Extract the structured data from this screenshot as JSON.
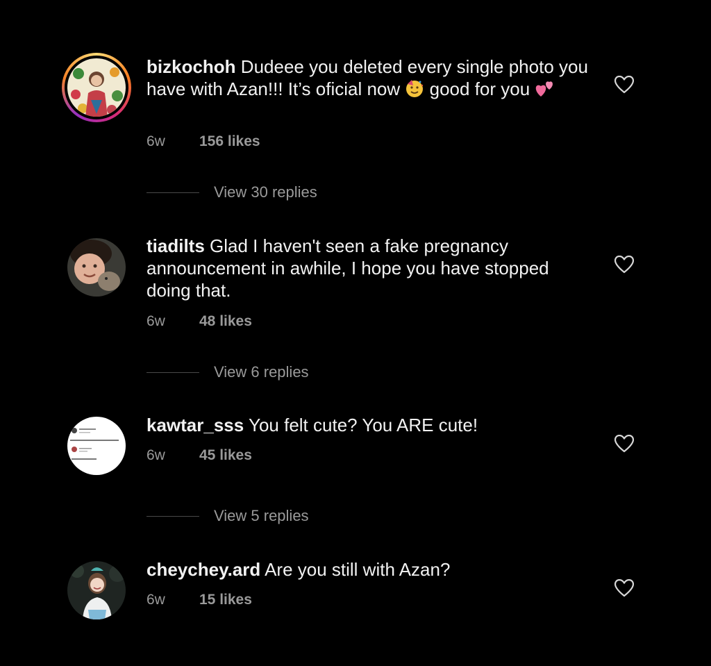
{
  "comments": [
    {
      "username": "bizkochoh",
      "text_part1": "Dudeee you deleted every single photo you have with Azan!!! It’s oficial now",
      "text_part2": "good for you",
      "emoji1": "partying-face-emoji",
      "emoji2": "two-hearts-emoji",
      "age": "6w",
      "likes": "156 likes",
      "replies": "View 30 replies",
      "has_story_ring": true
    },
    {
      "username": "tiadilts",
      "text": "Glad I haven't seen a fake pregnancy announcement in awhile, I hope you have stopped doing that.",
      "age": "6w",
      "likes": "48 likes",
      "replies": "View 6 replies"
    },
    {
      "username": "kawtar_sss",
      "text": "You felt cute? You ARE cute!",
      "age": "6w",
      "likes": "45 likes",
      "replies": "View 5 replies"
    },
    {
      "username": "cheychey.ard",
      "text": "Are you still with Azan?",
      "age": "6w",
      "likes": "15 likes"
    }
  ],
  "icons": {
    "like": "heart-outline-icon"
  },
  "colors": {
    "background": "#000000",
    "text": "#f2f2f2",
    "muted": "#9a9a9a"
  }
}
